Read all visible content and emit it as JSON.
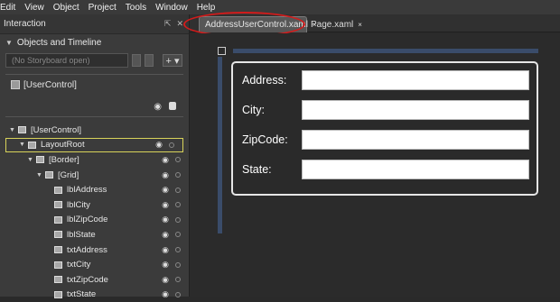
{
  "menu": [
    "Edit",
    "View",
    "Object",
    "Project",
    "Tools",
    "Window",
    "Help"
  ],
  "panel": {
    "title": "Interaction",
    "section_title": "Objects and Timeline",
    "storyboard_placeholder": "(No Storyboard open)",
    "add_label": "+ ▾",
    "root_label": "[UserControl]"
  },
  "tree": [
    {
      "label": "[UserControl]",
      "indent": 0
    },
    {
      "label": "LayoutRoot",
      "indent": 1,
      "selected": true
    },
    {
      "label": "[Border]",
      "indent": 2
    },
    {
      "label": "[Grid]",
      "indent": 3
    },
    {
      "label": "lblAddress",
      "indent": 4
    },
    {
      "label": "lblCity",
      "indent": 4
    },
    {
      "label": "lblZipCode",
      "indent": 4
    },
    {
      "label": "lblState",
      "indent": 4
    },
    {
      "label": "txtAddress",
      "indent": 4
    },
    {
      "label": "txtCity",
      "indent": 4
    },
    {
      "label": "txtZipCode",
      "indent": 4
    },
    {
      "label": "txtState",
      "indent": 4
    }
  ],
  "tabs": {
    "active": "AddressUserControl.xaml",
    "inactive": "Page.xaml",
    "close_glyph": "×"
  },
  "form": {
    "address_label": "Address:",
    "city_label": "City:",
    "zip_label": "ZipCode:",
    "state_label": "State:"
  },
  "colors": {
    "highlight_ring": "#d21b1b",
    "selection_outline": "#d8d35a",
    "ruler": "#3a4c6a"
  }
}
